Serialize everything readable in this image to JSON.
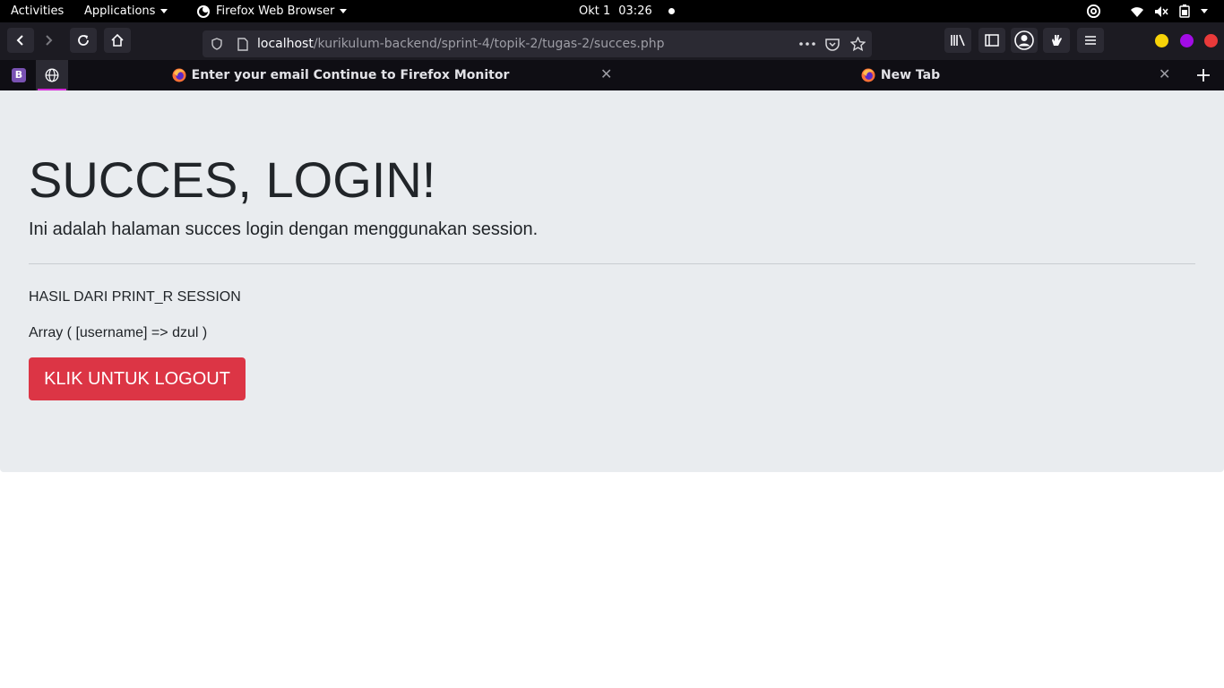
{
  "system_bar": {
    "activities": "Activities",
    "applications": "Applications",
    "app_name": "Firefox Web Browser",
    "date": "Okt 1",
    "time": "03:26"
  },
  "browser": {
    "url_host": "localhost",
    "url_path": "/kurikulum-backend/sprint-4/topik-2/tugas-2/succes.php",
    "pinned_tabs": [
      {
        "label": "B",
        "color": "#7952b3"
      },
      {
        "icon": "globe-icon"
      }
    ],
    "tabs": [
      {
        "title": "Enter your email Continue to Firefox Monitor",
        "icon": "firefox-icon"
      },
      {
        "title": "New Tab",
        "icon": "firefox-icon"
      }
    ],
    "window_controls": {
      "minimize": "#f7d308",
      "maximize": "#a20ce6",
      "close": "#e93a3a"
    },
    "active_tab_indicator": "#d32bd8"
  },
  "page": {
    "title": "SUCCES, LOGIN!",
    "lead": "Ini adalah halaman succes login dengan menggunakan session.",
    "session_heading": "HASIL DARI PRINT_R SESSION",
    "session_output": "Array ( [username] => dzul )",
    "logout_label": "KLIK UNTUK LOGOUT",
    "button_color": "#dc3545"
  }
}
